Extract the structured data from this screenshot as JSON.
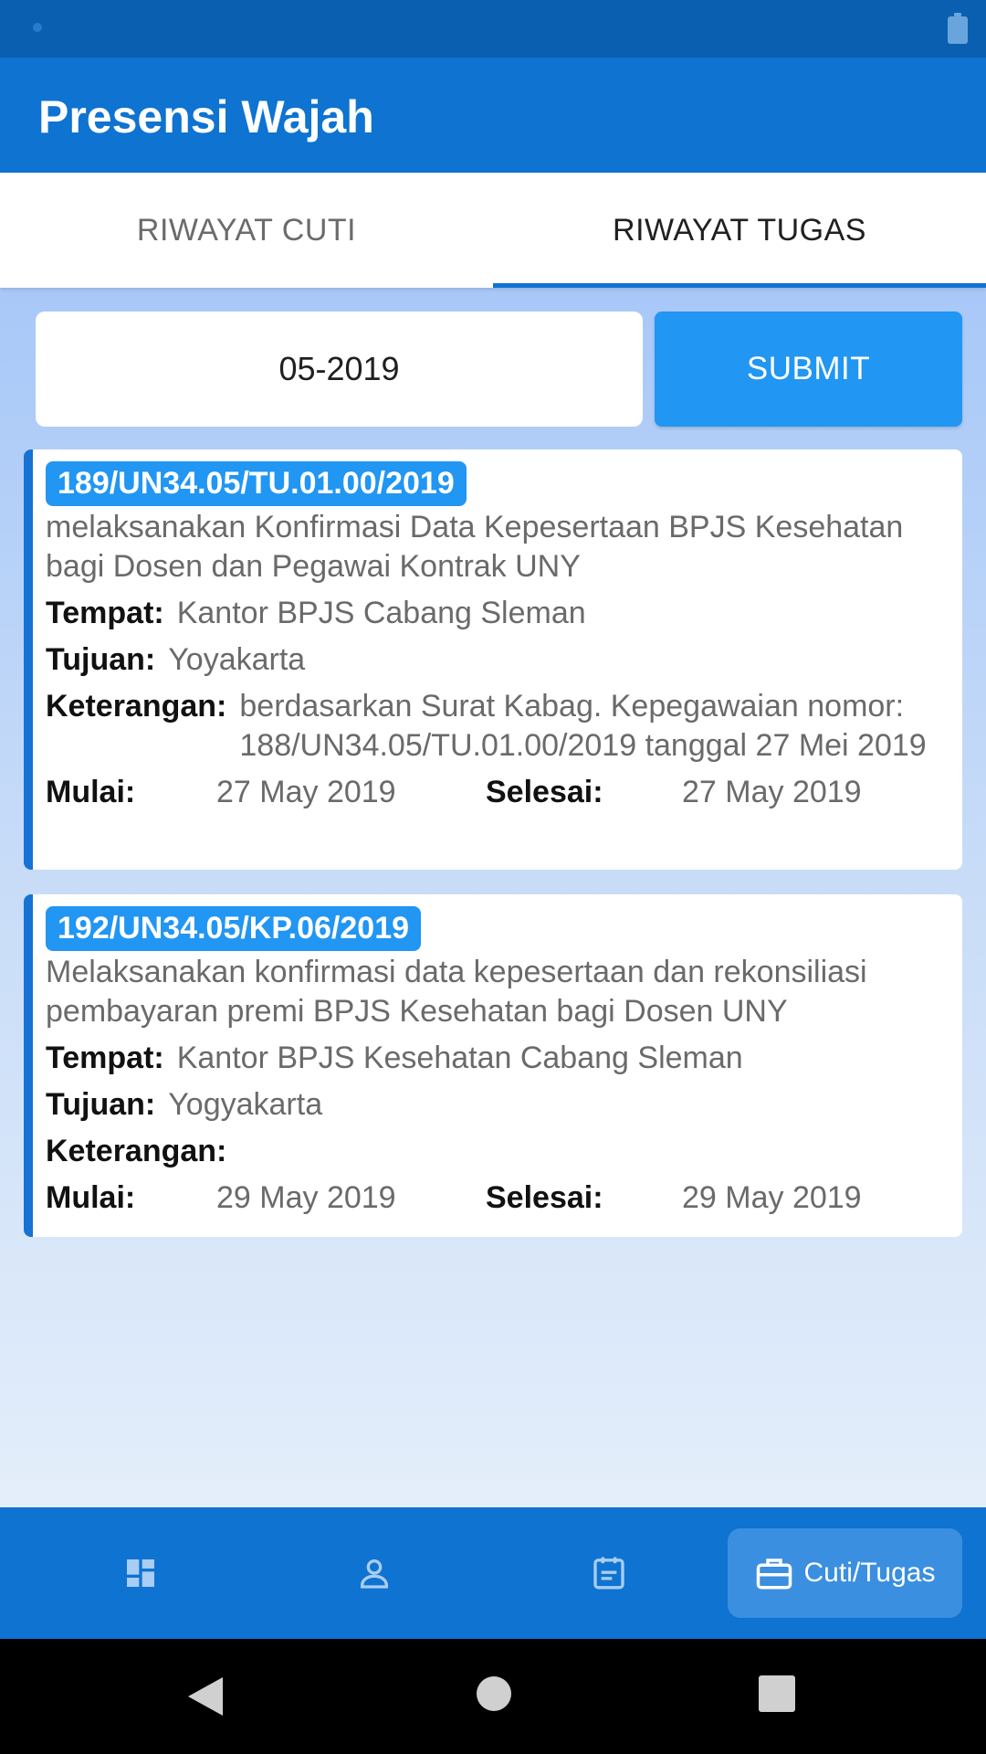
{
  "app": {
    "title": "Presensi Wajah"
  },
  "tabs": [
    {
      "label": "RIWAYAT CUTI",
      "selected": false
    },
    {
      "label": "RIWAYAT TUGAS",
      "selected": true
    }
  ],
  "filter": {
    "month_value": "05-2019",
    "submit_label": "SUBMIT"
  },
  "labels": {
    "tempat": "Tempat:",
    "tujuan": "Tujuan:",
    "keterangan": "Keterangan:",
    "mulai": "Mulai:",
    "selesai": "Selesai:"
  },
  "tasks": [
    {
      "number": "189/UN34.05/TU.01.00/2019",
      "description": "melaksanakan Konfirmasi Data Kepesertaan BPJS Kesehatan bagi Dosen dan Pegawai Kontrak UNY",
      "tempat": "Kantor BPJS Cabang Sleman",
      "tujuan": "Yoyakarta",
      "keterangan": "berdasarkan Surat Kabag. Kepegawaian nomor: 188/UN34.05/TU.01.00/2019 tanggal 27 Mei 2019",
      "mulai": "27 May 2019",
      "selesai": "27 May 2019"
    },
    {
      "number": "192/UN34.05/KP.06/2019",
      "description": "Melaksanakan konfirmasi data kepesertaan dan rekonsiliasi pembayaran premi BPJS Kesehatan bagi Dosen UNY",
      "tempat": "Kantor BPJS Kesehatan Cabang Sleman",
      "tujuan": "Yogyakarta",
      "keterangan": "",
      "mulai": "29 May 2019",
      "selesai": "29 May 2019"
    }
  ],
  "bottom_nav": {
    "items": [
      {
        "icon": "dashboard-icon",
        "label": ""
      },
      {
        "icon": "person-icon",
        "label": ""
      },
      {
        "icon": "calendar-icon",
        "label": ""
      },
      {
        "icon": "briefcase-icon",
        "label": "Cuti/Tugas",
        "selected": true
      }
    ]
  },
  "colors": {
    "primary": "#0e73d1",
    "accent": "#2196f3",
    "status_bar": "#0a5fb0"
  }
}
